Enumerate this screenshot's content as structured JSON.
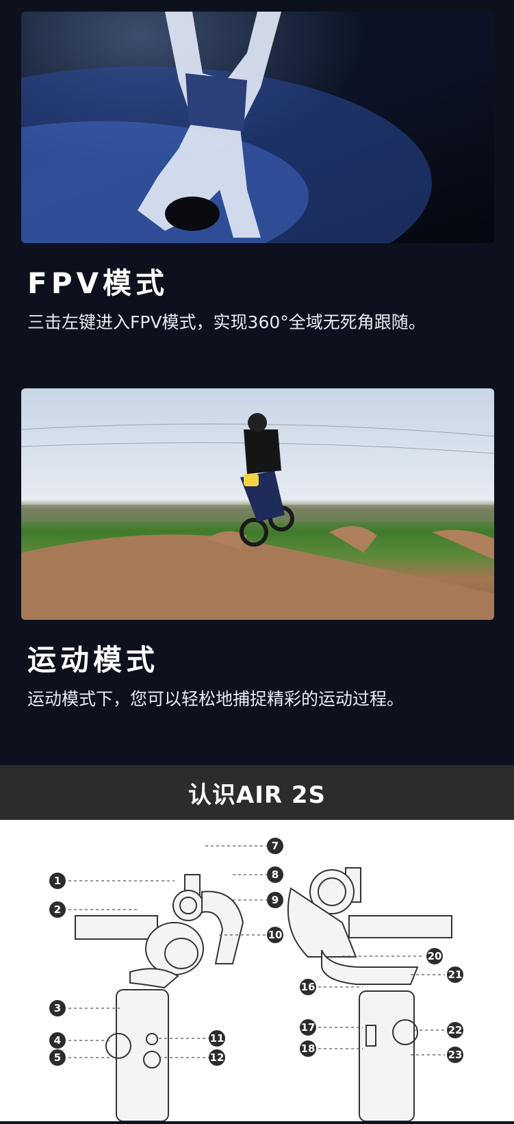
{
  "sections": [
    {
      "id": "fpv",
      "title": "FPV模式",
      "description": "三击左键进入FPV模式，实现360°全域无死角跟随。"
    },
    {
      "id": "sport",
      "title": "运动模式",
      "description": "运动模式下，您可以轻松地捕捉精彩的运动过程。"
    }
  ],
  "band": {
    "title": "认识AIR 2S"
  },
  "diagram": {
    "left_labels": [
      "1",
      "2",
      "3",
      "4",
      "5"
    ],
    "middle_labels": [
      "7",
      "8",
      "9",
      "10",
      "11",
      "12"
    ],
    "right_labels": [
      "16",
      "17",
      "18",
      "20",
      "21",
      "22",
      "23"
    ]
  },
  "colors": {
    "background": "#0c111d",
    "band": "#2c2c2e",
    "badge": "#2c2c2c"
  }
}
